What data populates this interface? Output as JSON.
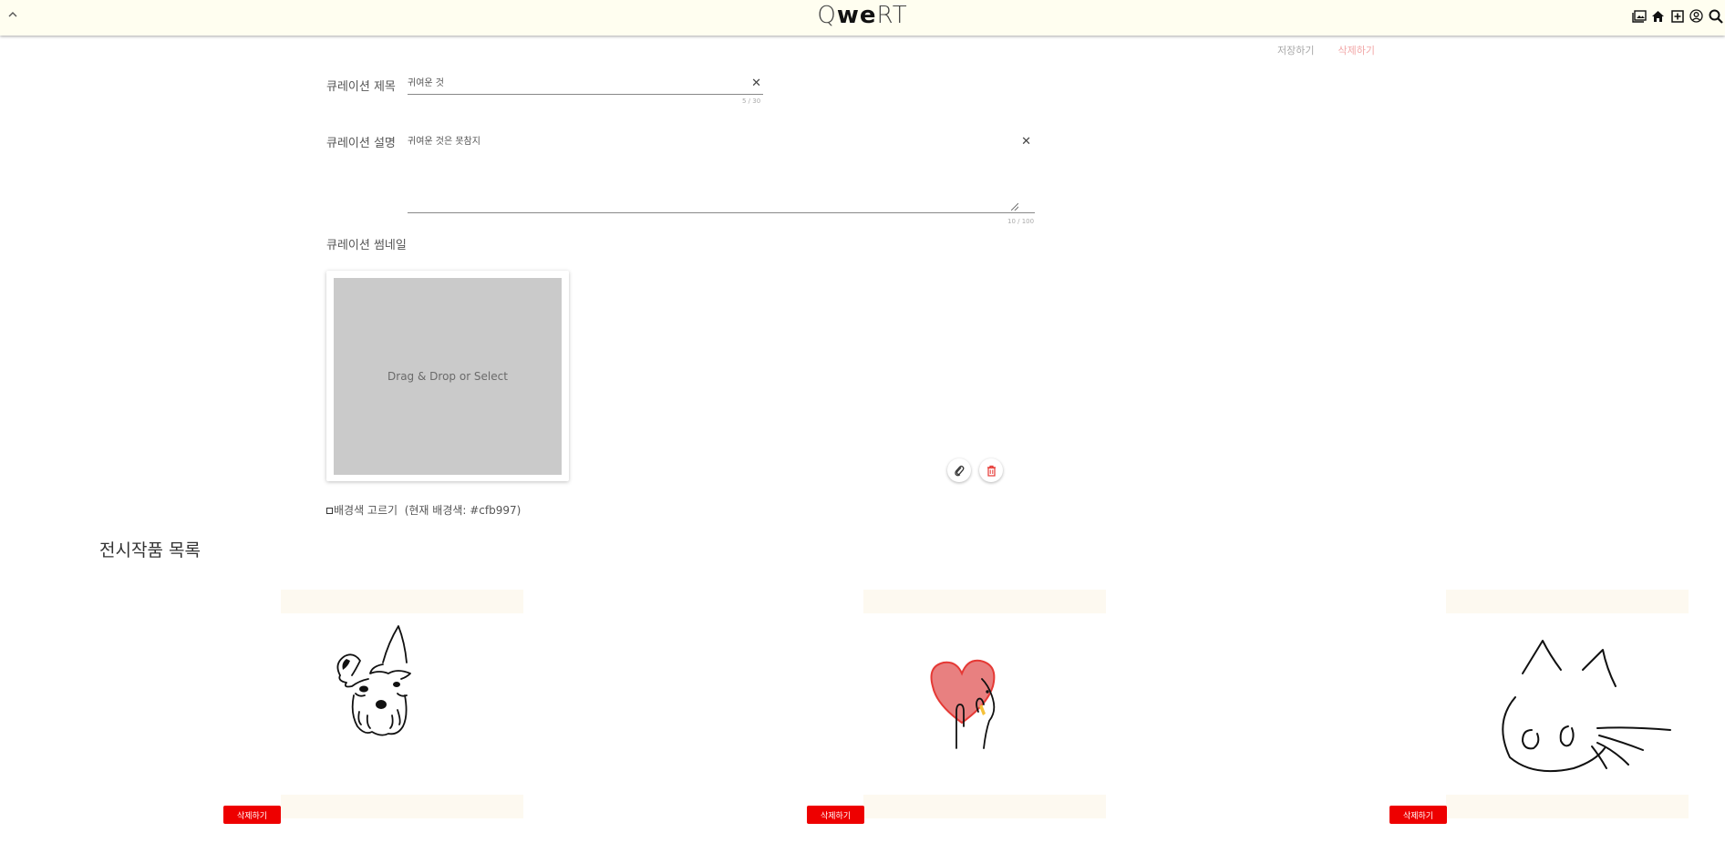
{
  "header": {
    "logo_light_1": "Q",
    "logo_bold": "we",
    "logo_light_2": "RT",
    "collapse_icon": "chevron-up-icon",
    "icons": [
      "gallery-icon",
      "home-icon",
      "add-box-icon",
      "account-circle-icon",
      "search-icon"
    ]
  },
  "actions": {
    "save_label": "저장하기",
    "delete_label": "삭제하기"
  },
  "form": {
    "title_label": "큐레이션 제목",
    "title_value": "귀여운 것",
    "title_counter": "5 / 30",
    "desc_label": "큐레이션 설명",
    "desc_value": "귀여운 것은 못참지",
    "desc_counter": "10 / 100",
    "thumb_label": "큐레이션 썸네일",
    "dropzone_text": "Drag & Drop or Select",
    "bg_picker_label": "배경색 고르기",
    "bg_current": "(현재 배경색: #cfb997)"
  },
  "artworks": {
    "section_title": "전시작품 목록",
    "items": [
      {
        "subject": "schnauzer-dog-drawing",
        "delete_label": "삭제하기"
      },
      {
        "subject": "heart-hand-drawing",
        "delete_label": "삭제하기"
      },
      {
        "subject": "cat-face-drawing",
        "delete_label": "삭제하기"
      }
    ]
  },
  "colors": {
    "topbar_bg": "#fffef0",
    "delete_red": "#ee0000",
    "heart_fill": "#e88080",
    "dropzone_gray": "#cacaca",
    "item_bar": "#fdf9f0"
  }
}
